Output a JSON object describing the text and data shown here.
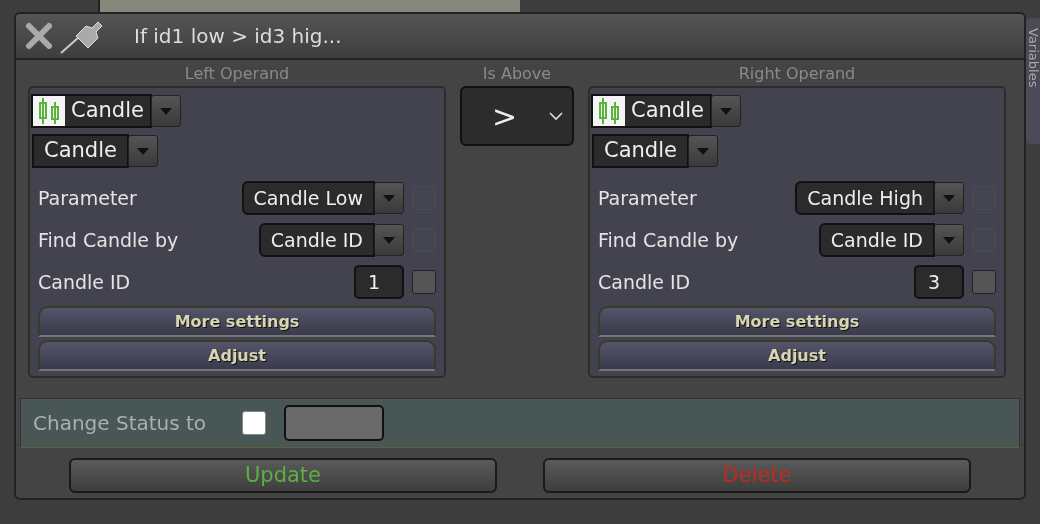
{
  "window": {
    "title": "If id1 low > id3 hig..."
  },
  "side_tab": {
    "label": "Variables"
  },
  "operator": {
    "header": "Is Above",
    "value": ">"
  },
  "operands": [
    {
      "header": "Left Operand",
      "source": "Candle",
      "type": "Candle",
      "fields": [
        {
          "kind": "dropdown",
          "label": "Parameter",
          "value": "Candle Low",
          "checkbox": {
            "checked": false,
            "disabled": true
          }
        },
        {
          "kind": "dropdown",
          "label": "Find Candle by",
          "value": "Candle ID",
          "checkbox": {
            "checked": false,
            "disabled": true
          }
        },
        {
          "kind": "number",
          "label": "Candle ID",
          "value": "1",
          "checkbox": {
            "checked": false,
            "disabled": false
          }
        }
      ],
      "buttons": [
        "More settings",
        "Adjust"
      ]
    },
    {
      "header": "Right Operand",
      "source": "Candle",
      "type": "Candle",
      "fields": [
        {
          "kind": "dropdown",
          "label": "Parameter",
          "value": "Candle High",
          "checkbox": {
            "checked": false,
            "disabled": true
          }
        },
        {
          "kind": "dropdown",
          "label": "Find Candle by",
          "value": "Candle ID",
          "checkbox": {
            "checked": false,
            "disabled": true
          }
        },
        {
          "kind": "number",
          "label": "Candle ID",
          "value": "3",
          "checkbox": {
            "checked": false,
            "disabled": false
          }
        }
      ],
      "buttons": [
        "More settings",
        "Adjust"
      ]
    }
  ],
  "status": {
    "label": "Change Status to",
    "checked": false
  },
  "actions": [
    {
      "label": "Update",
      "kind": "confirm"
    },
    {
      "label": "Delete",
      "kind": "danger"
    }
  ]
}
